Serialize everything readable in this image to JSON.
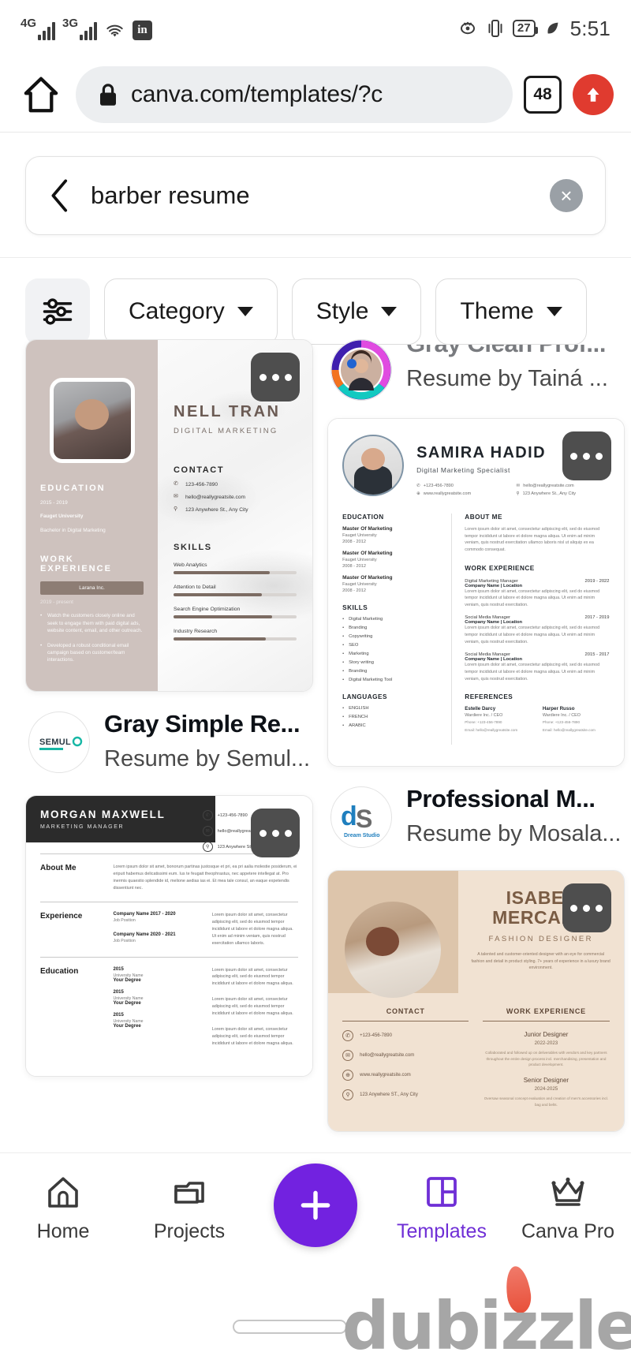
{
  "status_bar": {
    "network_1": "4G",
    "network_2": "3G",
    "wifi_icon": "wifi-icon",
    "app_icon": "in",
    "eye_icon": "eye-icon",
    "vibrate_icon": "vibrate-icon",
    "battery_percent": "27",
    "leaf_icon": "leaf-icon",
    "time": "5:51"
  },
  "browser": {
    "home_icon": "home-icon",
    "lock_icon": "lock-icon",
    "url": "canva.com/templates/?c",
    "tab_count": "48",
    "upload_icon": "upload-arrow-icon"
  },
  "search": {
    "back_icon": "back-chevron-icon",
    "query": "barber resume",
    "clear_icon": "×"
  },
  "filters": {
    "icon": "filter-sliders-icon",
    "pills": [
      {
        "label": "Category"
      },
      {
        "label": "Style"
      },
      {
        "label": "Theme"
      }
    ]
  },
  "results": {
    "left_column": [
      {
        "title": "Gray Simple Re...",
        "author": "Resume by Semul...",
        "brand": "SEMULO",
        "more_icon": "more-options-icon",
        "template": {
          "name": "NELL TRAN",
          "role": "DIGITAL MARKETING",
          "education_heading": "EDUCATION",
          "education_years": "2015 - 2019",
          "education_school": "Fauget University",
          "education_degree": "Bachelor in Digital Marketing",
          "work_heading": "WORK EXPERIENCE",
          "company": "Larana Inc.",
          "company_dates": "2019 - present",
          "bullets": [
            "Watch the customers closely online and seek to engage them with paid digital ads, website content, email, and other outreach.",
            "Developed a robust conditional email campaign based on customer/team interactions."
          ],
          "contact_heading": "CONTACT",
          "contacts": [
            {
              "icon": "phone-icon",
              "text": "123-456-7890"
            },
            {
              "icon": "mail-icon",
              "text": "hello@reallygreatsite.com"
            },
            {
              "icon": "pin-icon",
              "text": "123 Anywhere St., Any City"
            }
          ],
          "skills_heading": "SKILLS",
          "skills": [
            {
              "name": "Web Analytics",
              "level": 78
            },
            {
              "name": "Attention to Detail",
              "level": 72
            },
            {
              "name": "Search Engine Optimization",
              "level": 80
            },
            {
              "name": "Industry Research",
              "level": 75
            }
          ]
        }
      },
      {
        "title": "",
        "author": "",
        "brand": "",
        "more_icon": "more-options-icon",
        "template": {
          "name": "MORGAN MAXWELL",
          "role": "MARKETING MANAGER",
          "contacts": [
            {
              "icon": "phone-icon",
              "text": "+123-456-7890"
            },
            {
              "icon": "mail-icon",
              "text": "hello@reallygreatsite.com"
            },
            {
              "icon": "pin-icon",
              "text": "123 Anywhere St., Any City"
            }
          ],
          "sections": [
            {
              "label": "About Me",
              "mid_title": "",
              "mid_sub": "",
              "text": "Lorem ipsum dolor sit amet, bonorum partinas justosque et pri, ea pri aalia molestie posiderum, ei eripuit habemus delicatissimi eum. Ius te feugait theophrastus, nec appetere intellegat at. Pro inermis quaestio splendide id, melione aedias ias ei. Et mea tale consul, an eaque expetendis dissentiunt nec."
            },
            {
              "label": "Experience",
              "mid_title": "Company Name 2017 - 2020",
              "mid_sub": "Job Position",
              "text": "Lorem ipsum dolor sit amet, consectetur adipiscing elit, sed do eiusmod tempor incididunt ut labore et dolore magna aliqua. Ut enim ad minim veniam, quis nostrud exercitation ullamco laboris."
            },
            {
              "label": "",
              "mid_title": "Company Name 2020 - 2021",
              "mid_sub": "Job Position",
              "text": "Lorem ipsum dolor sit amet, consectetur adipiscing elit, sed do eiusmod tempor incididunt ut labore et dolore magna aliqua. Ut enim ad minim veniam, quis nostrud exercitation ullamco laboris."
            },
            {
              "label": "Education",
              "mid_title": "2015",
              "mid_sub": "University Name",
              "degree": "Your Degree",
              "text": "Lorem ipsum dolor sit amet, consectetur adipiscing elit, sed do eiusmod tempor incididunt ut labore et dolore magna aliqua."
            }
          ],
          "edu_entries": [
            {
              "year": "2015",
              "uni": "University Name",
              "degree": "Your Degree",
              "text": "Lorem ipsum dolor sit amet, consectetur adipiscing elit, sed do eiusmod tempor incididunt ut labore et dolore magna aliqua."
            },
            {
              "year": "2015",
              "uni": "University Name",
              "degree": "Your Degree",
              "text": "Lorem ipsum dolor sit amet, consectetur adipiscing elit, sed do eiusmod tempor incididunt ut labore et dolore magna aliqua."
            },
            {
              "year": "2015",
              "uni": "University Name",
              "degree": "Your Degree",
              "text": "Lorem ipsum dolor sit amet, consectetur adipiscing elit, sed do eiusmod tempor incididunt ut labore et dolore magna aliqua."
            }
          ]
        }
      }
    ],
    "right_column": [
      {
        "title": "Gray Clean Prof...",
        "author": "Resume by Tainá ...",
        "brand": "avatar-ring"
      },
      {
        "title": "Professional M...",
        "author": "Resume by Mosala...",
        "brand": "Dream Studio",
        "more_icon": "more-options-icon",
        "template": {
          "name": "SAMIRA HADID",
          "role": "Digital Marketing Specialist",
          "contacts": [
            {
              "icon": "phone-icon",
              "text": "+123-456-7890"
            },
            {
              "icon": "mail-icon",
              "text": "hello@reallygreatsite.com"
            },
            {
              "icon": "web-icon",
              "text": "www.reallygreatsite.com"
            },
            {
              "icon": "pin-icon",
              "text": "123 Anywhere St., Any City"
            }
          ],
          "education_heading": "EDUCATION",
          "education": [
            {
              "degree": "Master Of Marketing",
              "uni": "Fauget University",
              "years": "2008 - 2012"
            },
            {
              "degree": "Master Of Marketing",
              "uni": "Fauget University",
              "years": "2008 - 2012"
            },
            {
              "degree": "Master Of Marketing",
              "uni": "Fauget University",
              "years": "2008 - 2012"
            }
          ],
          "skills_heading": "SKILLS",
          "skills": [
            "Digital Marketing",
            "Branding",
            "Copywriting",
            "SEO",
            "Marketing",
            "Story writing",
            "Branding",
            "Digital Marketing Tool"
          ],
          "languages_heading": "LANGUAGES",
          "languages": [
            "ENGLISH",
            "FRENCH",
            "ARABIC"
          ],
          "about_heading": "ABOUT ME",
          "about_text": "Lorem ipsum dolor sit amet, consectetur adipiscing elit, sed do eiusmod tempor incididunt ut labore et dolore magna aliqua. Ut enim ad minim veniam, quis nostrud exercitation ullamco laboris nisl ut aliquip ex ea commodo consequat.",
          "work_heading": "WORK EXPERIENCE",
          "jobs": [
            {
              "title": "Digital Marketing Manager",
              "years": "2019 - 2022",
              "company": "Company Name | Location",
              "text": "Lorem ipsum dolor sit amet, consectetur adipiscing elit, sed do eiusmod tempor incididunt ut labore et dolore magna aliqua. Ut enim ad minim veniam, quis nostrud exercitation."
            },
            {
              "title": "Social Media Manager",
              "years": "2017 - 2019",
              "company": "Company Name | Location",
              "text": "Lorem ipsum dolor sit amet, consectetur adipiscing elit, sed do eiusmod tempor incididunt ut labore et dolore magna aliqua. Ut enim ad minim veniam, quis nostrud exercitation."
            },
            {
              "title": "Social Media Manager",
              "years": "2015 - 2017",
              "company": "Company Name | Location",
              "text": "Lorem ipsum dolor sit amet, consectetur adipiscing elit, sed do eiusmod tempor incididunt ut labore et dolore magna aliqua. Ut enim ad minim veniam, quis nostrud exercitation."
            }
          ],
          "references_heading": "REFERENCES",
          "references": [
            {
              "name": "Estelle Darcy",
              "role": "Wardiere Inc. / CEO",
              "phone": "Phone: +123-456-7890",
              "email": "Email: hello@reallygreatsite.com"
            },
            {
              "name": "Harper Russo",
              "role": "Wardiere Inc. / CEO",
              "phone": "Phone: +123-456-7890",
              "email": "Email: hello@reallygreatsite.com"
            }
          ]
        }
      },
      {
        "title": "",
        "author": "",
        "brand": "",
        "more_icon": "more-options-icon",
        "template": {
          "name_line1": "ISABEL",
          "name_line2": "MERCADO",
          "role": "FASHION DESIGNER",
          "bio": "A talented and customer-oriented designer with an eye for commercial fashion and detail in product styling. 7+ years of experience in a luxury brand environment.",
          "contact_heading": "CONTACT",
          "contacts": [
            {
              "icon": "phone-icon",
              "text": "+123-456-7890"
            },
            {
              "icon": "mail-icon",
              "text": "hello@reallygreatsite.com"
            },
            {
              "icon": "web-icon",
              "text": "www.reallygreatsite.com"
            },
            {
              "icon": "pin-icon",
              "text": "123 Anywhere ST., Any City"
            }
          ],
          "work_heading": "WORK EXPERIENCE",
          "jobs": [
            {
              "title": "Junior Designer",
              "years": "2022-2023",
              "text": "Collaborated and followed up on deliverables with vendors and key partners throughout the entire design process incl. merchandising, presentation and product development."
            },
            {
              "title": "Senior Designer",
              "years": "2024-2025",
              "text": "Oversaw seasonal concept evaluation and creation of men's accessories incl. bag and belts."
            }
          ]
        }
      }
    ]
  },
  "bottom_nav": {
    "items": [
      {
        "label": "Home",
        "icon": "home-icon",
        "active": false
      },
      {
        "label": "Projects",
        "icon": "folder-icon",
        "active": false
      },
      {
        "label": "Templates",
        "icon": "templates-grid-icon",
        "active": true
      },
      {
        "label": "Canva Pro",
        "icon": "crown-icon",
        "active": false
      }
    ],
    "create_icon": "plus-icon",
    "accent_color": "#7222e0"
  },
  "watermark": {
    "text": "dubizzle",
    "flame_icon": "flame-icon"
  }
}
